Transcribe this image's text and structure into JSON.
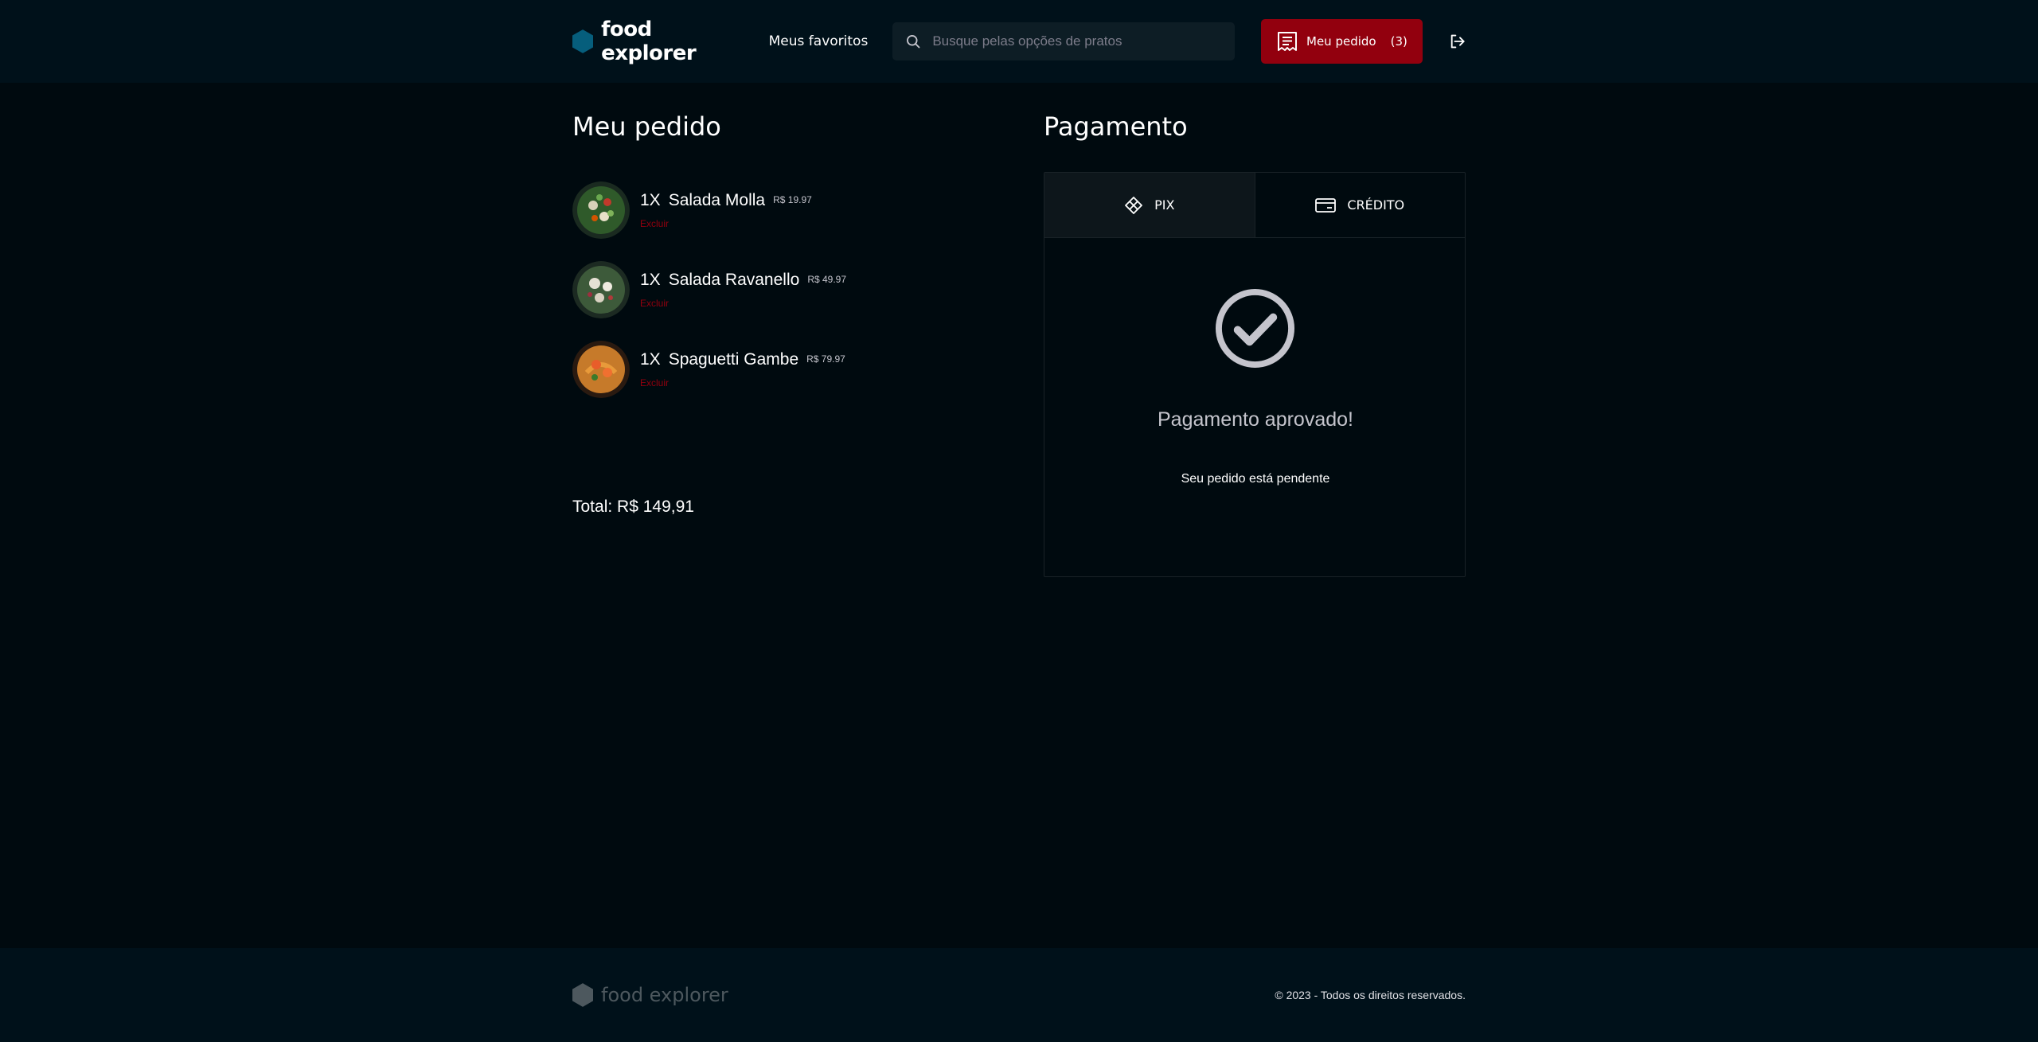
{
  "header": {
    "brand": "food explorer",
    "favorites_label": "Meus favoritos",
    "search_placeholder": "Busque pelas opções de pratos",
    "order_button": {
      "label": "Meu pedido",
      "count": "(3)"
    },
    "logout_icon": "sign-out-icon"
  },
  "order": {
    "title": "Meu pedido",
    "items": [
      {
        "qty": "1X",
        "name": "Salada Molla",
        "price": "R$ 19.97",
        "remove": "Excluir"
      },
      {
        "qty": "1X",
        "name": "Salada Ravanello",
        "price": "R$ 49.97",
        "remove": "Excluir"
      },
      {
        "qty": "1X",
        "name": "Spaguetti Gambe",
        "price": "R$ 79.97",
        "remove": "Excluir"
      }
    ],
    "total": "Total: R$ 149,91"
  },
  "payment": {
    "title": "Pagamento",
    "tabs": [
      {
        "label": "PIX",
        "icon": "pix-icon",
        "active": true
      },
      {
        "label": "CRÉDITO",
        "icon": "credit-card-icon",
        "active": false
      }
    ],
    "status_title": "Pagamento aprovado!",
    "status_subtitle": "Seu pedido está pendente"
  },
  "footer": {
    "brand": "food explorer",
    "copyright": "© 2023 - Todos os direitos reservados."
  },
  "colors": {
    "background": "#000a0f",
    "header": "#00111a",
    "accent_red": "#92000e",
    "brand_blue": "#065e7c"
  }
}
